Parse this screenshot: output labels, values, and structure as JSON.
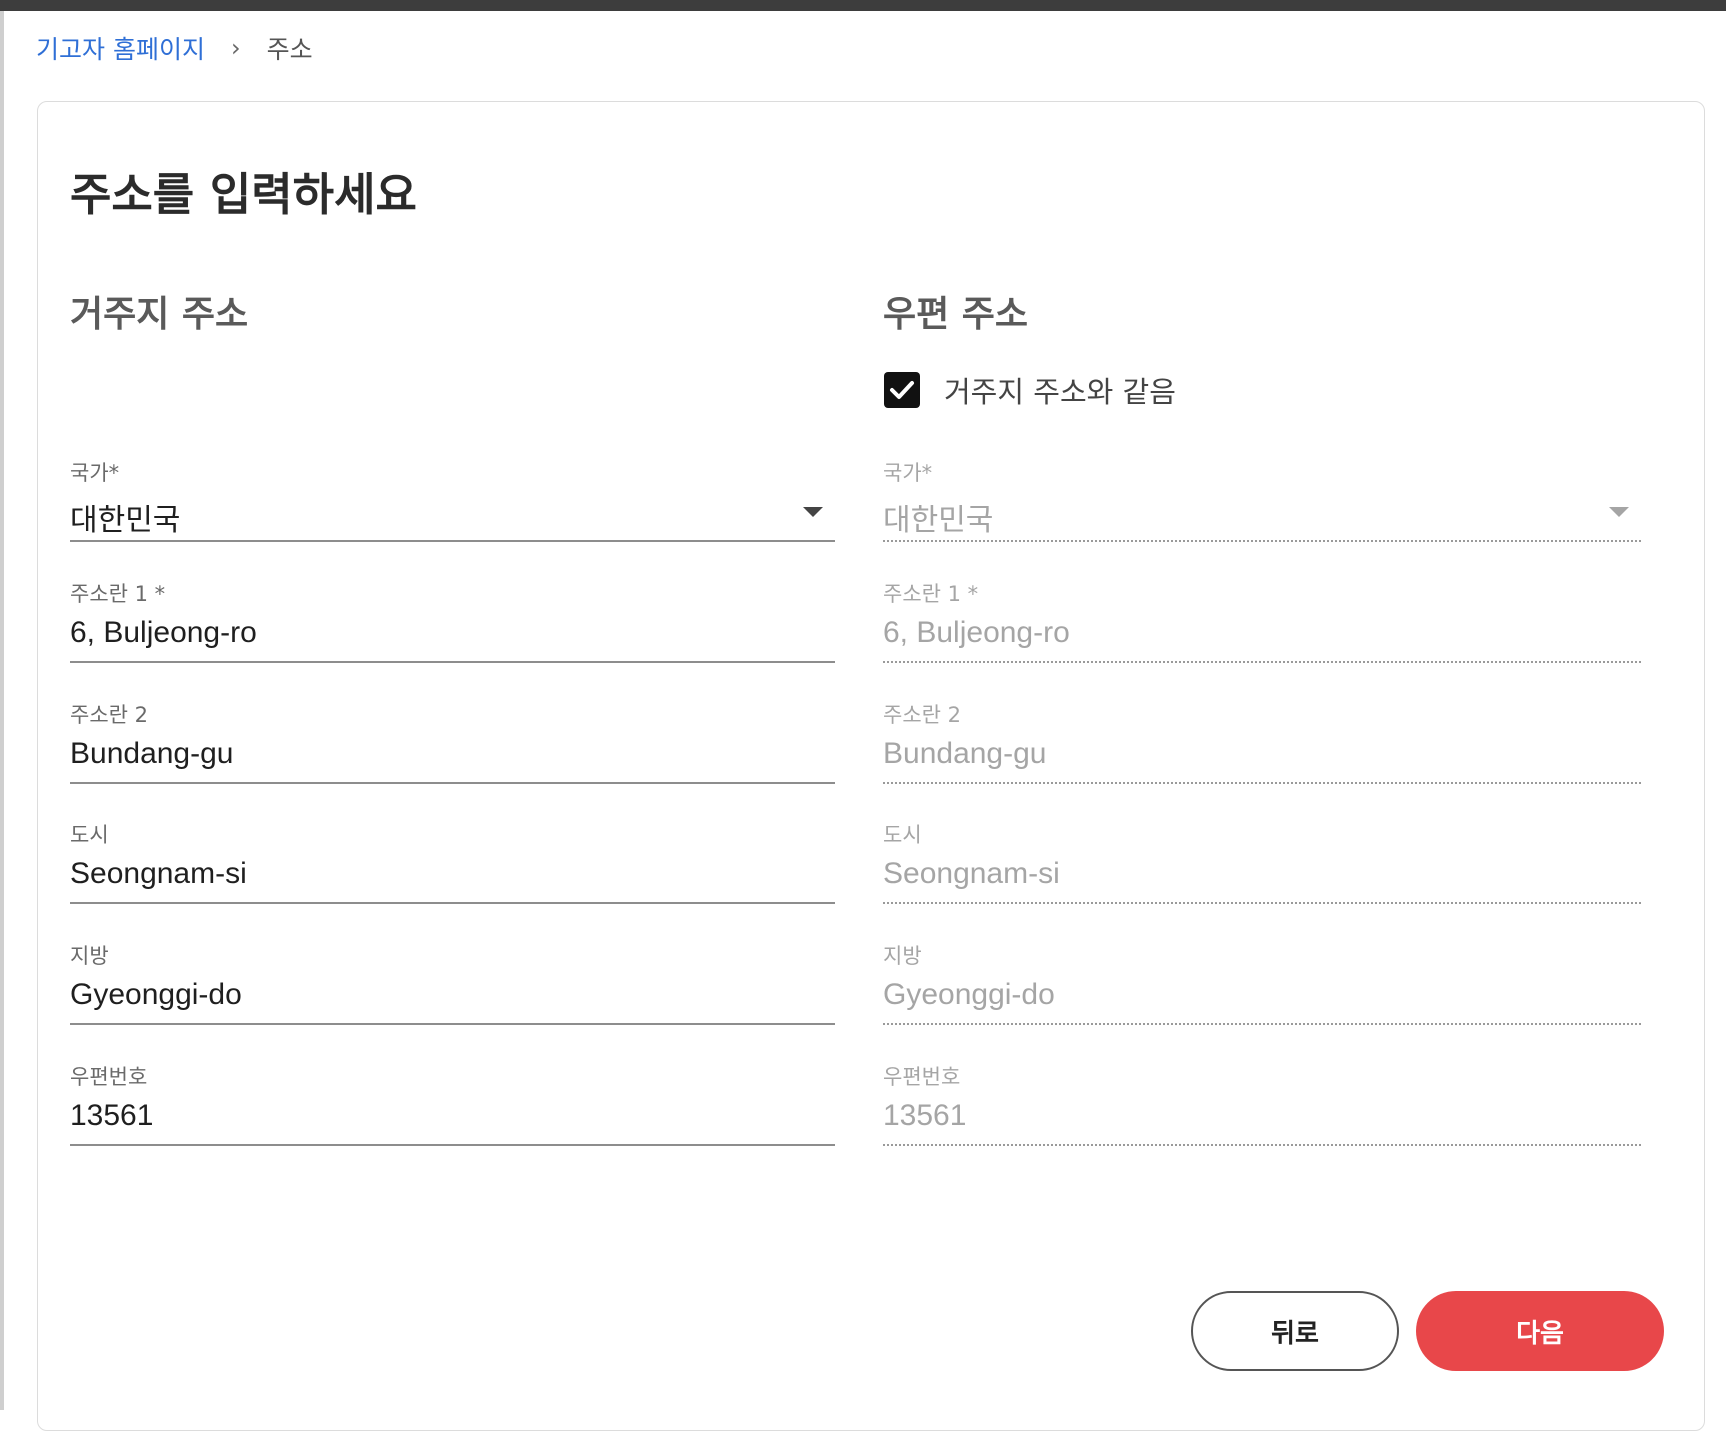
{
  "breadcrumb": {
    "home": "기고자 홈페이지",
    "separator": "›",
    "current": "주소"
  },
  "page_title": "주소를 입력하세요",
  "residential": {
    "title": "거주지 주소",
    "fields": [
      {
        "label": "국가*",
        "value": "대한민국"
      },
      {
        "label": "주소란 1 *",
        "value": "6, Buljeong-ro"
      },
      {
        "label": "주소란 2",
        "value": "Bundang-gu"
      },
      {
        "label": "도시",
        "value": "Seongnam-si"
      },
      {
        "label": "지방",
        "value": "Gyeonggi-do"
      },
      {
        "label": "우편번호",
        "value": "13561"
      }
    ]
  },
  "mailing": {
    "title": "우편 주소",
    "same_as_label": "거주지 주소와 같음",
    "same_as_checked": true,
    "fields": [
      {
        "label": "국가*",
        "value": "대한민국"
      },
      {
        "label": "주소란 1 *",
        "value": "6, Buljeong-ro"
      },
      {
        "label": "주소란 2",
        "value": "Bundang-gu"
      },
      {
        "label": "도시",
        "value": "Seongnam-si"
      },
      {
        "label": "지방",
        "value": "Gyeonggi-do"
      },
      {
        "label": "우편번호",
        "value": "13561"
      }
    ]
  },
  "buttons": {
    "back": "뒤로",
    "next": "다음"
  },
  "colors": {
    "link": "#2f6fd6",
    "primary": "#e8474a",
    "checkbox": "#111111"
  },
  "icons": {
    "dropdown": "caret-down-icon",
    "checkbox": "check-icon"
  }
}
